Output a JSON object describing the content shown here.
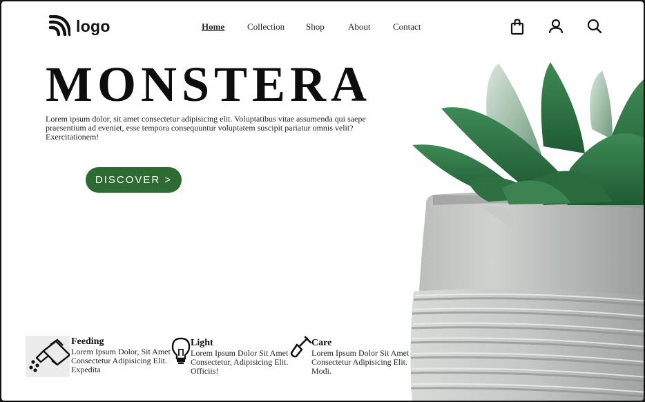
{
  "header": {
    "logo_text": "logo",
    "nav": [
      {
        "label": "Home",
        "active": true
      },
      {
        "label": "Collection",
        "active": false
      },
      {
        "label": "Shop",
        "active": false
      },
      {
        "label": "About",
        "active": false
      },
      {
        "label": "Contact",
        "active": false
      }
    ],
    "icons": [
      "shopping-bag-icon",
      "user-icon",
      "search-icon"
    ]
  },
  "hero": {
    "title": "MONSTERA",
    "description": "Lorem ipsum dolor, sit amet consectetur adipisicing elit. Voluptatibus vitae assumenda qui saepe praesentium ad eveniet, esse tempora consequuntur voluptatem suscipit pariatur omnis velit? Exercitationem!",
    "cta_label": "DISCOVER >",
    "cta_color": "#2e6b33"
  },
  "features": [
    {
      "icon": "watering-can-icon",
      "title": "Feeding",
      "description": "Lorem Ipsum Dolor, Sit Amet Consectetur Adipisicing Elit. Expedita"
    },
    {
      "icon": "light-bulb-icon",
      "title": "Light",
      "description": "Lorem Ipsum Dolor Sit Amet Consectetur, Adipisicing Elit. Officiis!"
    },
    {
      "icon": "shovel-icon",
      "title": "Care",
      "description": "Lorem Ipsum Dolor Sit Amet Consectetur Adipisicing Elit. Modi."
    }
  ]
}
